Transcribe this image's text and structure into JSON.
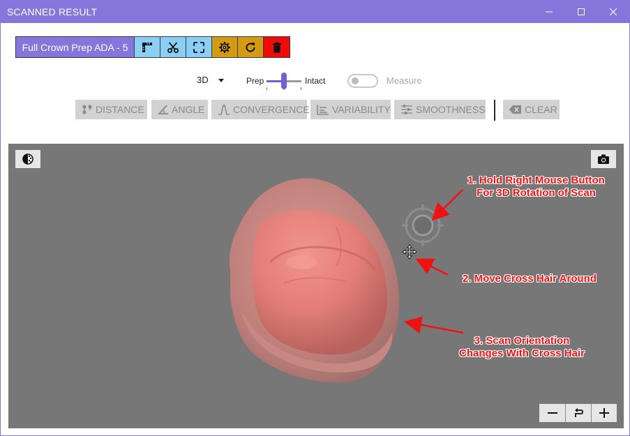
{
  "window": {
    "title": "SCANNED RESULT"
  },
  "toolbar": {
    "case_name": "Full Crown Prep ADA - 5",
    "buttons": [
      {
        "icon": "ruler-icon",
        "color": "#8ccff6"
      },
      {
        "icon": "scissors-icon",
        "color": "#8ccff6"
      },
      {
        "icon": "fit-frame-icon",
        "color": "#8ccff6"
      },
      {
        "icon": "gear-icon",
        "color": "#d39a14"
      },
      {
        "icon": "refresh-icon",
        "color": "#d39a14"
      },
      {
        "icon": "trash-icon",
        "color": "#ee0b0b"
      }
    ]
  },
  "view_controls": {
    "view_mode": "3D",
    "slider_left_label": "Prep",
    "slider_right_label": "Intact",
    "measure_label": "Measure",
    "measure_on": false
  },
  "measure_tools": {
    "distance": "DISTANCE",
    "angle": "ANGLE",
    "convergence": "CONVERGENCE",
    "variability": "VARIABILITY",
    "smoothness": "SMOOTHNESS",
    "clear": "CLEAR"
  },
  "annotations": {
    "step1_line1": "1. Hold Right Mouse Button",
    "step1_line2": "For 3D Rotation of Scan",
    "step2": "2. Move Cross Hair Around",
    "step3_line1": "3. Scan Orientation",
    "step3_line2": "Changes With Cross Hair"
  },
  "colors": {
    "accent": "#8676dc",
    "viewport_bg": "#777777",
    "annotation": "#ee1212",
    "scan_tooth": "#e8857f"
  }
}
